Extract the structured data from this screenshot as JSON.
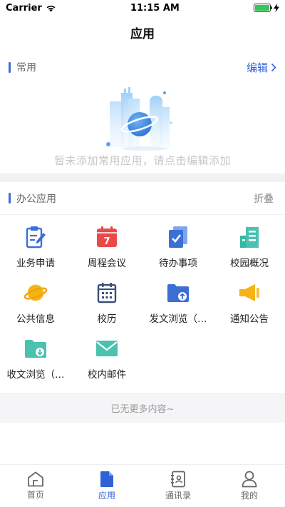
{
  "status_bar": {
    "carrier": "Carrier",
    "time": "11:15 AM"
  },
  "nav": {
    "title": "应用"
  },
  "favorites": {
    "title": "常用",
    "edit_label": "编辑",
    "empty_text": "暂未添加常用应用，请点击编辑添加"
  },
  "office": {
    "title": "办公应用",
    "collapse_label": "折叠",
    "items": [
      {
        "label": "业务申请",
        "icon": "clipboard-edit-icon",
        "color": "#3b6fd6"
      },
      {
        "label": "周程会议",
        "icon": "calendar-7-icon",
        "color": "#e84a4a"
      },
      {
        "label": "待办事项",
        "icon": "todo-check-icon",
        "color": "#3b6fd6"
      },
      {
        "label": "校园概况",
        "icon": "building-icon",
        "color": "#35b8a6"
      },
      {
        "label": "公共信息",
        "icon": "planet-icon",
        "color": "#f5b316"
      },
      {
        "label": "校历",
        "icon": "school-calendar-icon",
        "color": "#3a4f7a"
      },
      {
        "label": "发文浏览（…",
        "icon": "folder-upload-icon",
        "color": "#3b6fd6"
      },
      {
        "label": "通知公告",
        "icon": "megaphone-icon",
        "color": "#f5b316"
      },
      {
        "label": "收文浏览（…",
        "icon": "folder-download-icon",
        "color": "#4bc1b0"
      },
      {
        "label": "校内邮件",
        "icon": "mail-icon",
        "color": "#4bc1b0"
      }
    ]
  },
  "footer_note": "已无更多内容~",
  "tabs": [
    {
      "label": "首页",
      "icon": "home-icon",
      "active": false
    },
    {
      "label": "应用",
      "icon": "app-file-icon",
      "active": true
    },
    {
      "label": "通讯录",
      "icon": "contacts-icon",
      "active": false
    },
    {
      "label": "我的",
      "icon": "profile-icon",
      "active": false
    }
  ],
  "colors": {
    "accent": "#2f62d6",
    "section_bar": "#3b6fd6",
    "empty_text": "#c7c7cc"
  }
}
